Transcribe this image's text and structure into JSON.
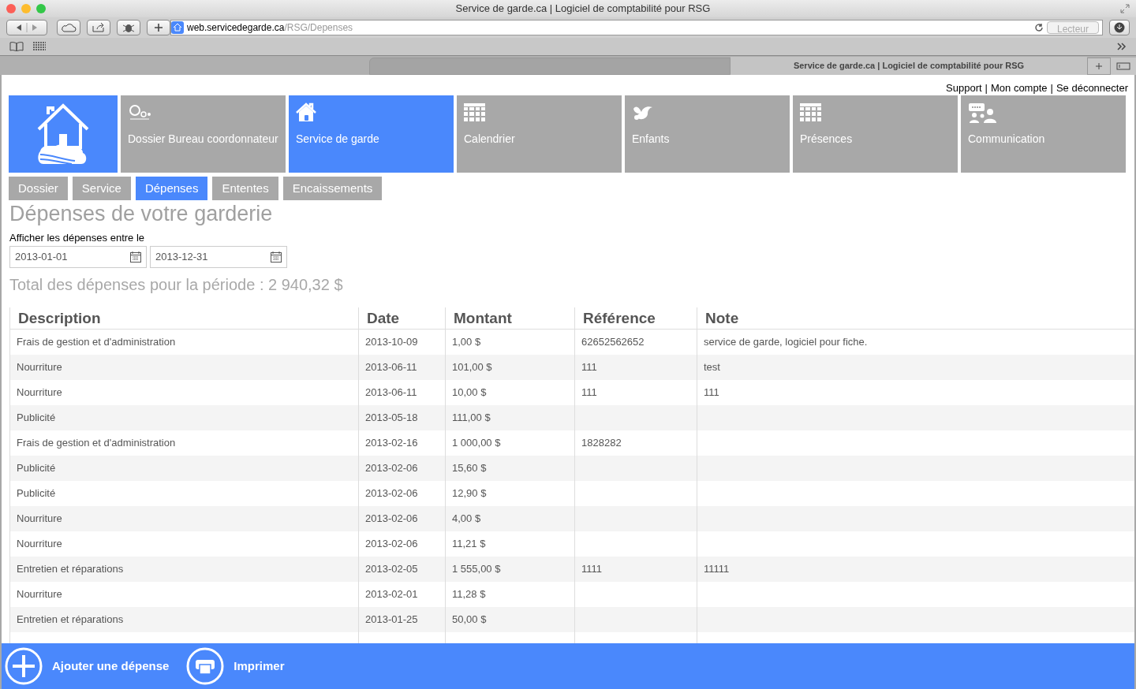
{
  "window": {
    "title": "Service de garde.ca | Logiciel de comptabilité pour RSG"
  },
  "address_bar": {
    "host": "web.servicedegarde.ca",
    "path": "/RSG/Depenses",
    "reader_button": "Lecteur"
  },
  "tab": {
    "title": "Service de garde.ca | Logiciel de comptabilité pour RSG"
  },
  "top_links": [
    {
      "kind": "link",
      "text": "Support"
    },
    {
      "kind": "separator",
      "text": "|"
    },
    {
      "kind": "link",
      "text": "Mon compte"
    },
    {
      "kind": "separator",
      "text": "|"
    },
    {
      "kind": "link",
      "text": "Se déconnecter"
    }
  ],
  "nav_tiles": [
    {
      "kind": "logo",
      "selected": true
    },
    {
      "kind": "balloon",
      "label": "Dossier Bureau coordonnateur",
      "selected": false
    },
    {
      "kind": "house",
      "label": "Service de garde",
      "selected": true
    },
    {
      "kind": "grid",
      "label": "Calendrier",
      "selected": false
    },
    {
      "kind": "bird",
      "label": "Enfants",
      "selected": false
    },
    {
      "kind": "grid",
      "label": "Présences",
      "selected": false
    },
    {
      "kind": "people",
      "label": "Communication",
      "selected": false
    }
  ],
  "sub_tabs": [
    {
      "label": "Dossier",
      "selected": false
    },
    {
      "label": "Service",
      "selected": false
    },
    {
      "label": "Dépenses",
      "selected": true
    },
    {
      "label": "Ententes",
      "selected": false
    },
    {
      "label": "Encaissements",
      "selected": false
    }
  ],
  "heading": "Dépenses de votre garderie",
  "filter": {
    "label": "Afficher les dépenses entre le",
    "start": "2013-01-01",
    "end": "2013-12-31"
  },
  "total": "Total des dépenses pour la période : 2 940,32 $",
  "table": {
    "columns": [
      "Description",
      "Date",
      "Montant",
      "Référence",
      "Note"
    ],
    "rows": [
      [
        "Frais de gestion et d'administration",
        "2013-10-09",
        "1,00 $",
        "62652562652",
        "service de garde, logiciel pour fiche."
      ],
      [
        "Nourriture",
        "2013-06-11",
        "101,00 $",
        "111",
        "test"
      ],
      [
        "Nourriture",
        "2013-06-11",
        "10,00 $",
        "111",
        "111"
      ],
      [
        "Publicité",
        "2013-05-18",
        "111,00 $",
        "",
        ""
      ],
      [
        "Frais de gestion et d'administration",
        "2013-02-16",
        "1 000,00 $",
        "1828282",
        ""
      ],
      [
        "Publicité",
        "2013-02-06",
        "15,60 $",
        "",
        ""
      ],
      [
        "Publicité",
        "2013-02-06",
        "12,90 $",
        "",
        ""
      ],
      [
        "Nourriture",
        "2013-02-06",
        "4,00 $",
        "",
        ""
      ],
      [
        "Nourriture",
        "2013-02-06",
        "11,21 $",
        "",
        ""
      ],
      [
        "Entretien et réparations",
        "2013-02-05",
        "1 555,00 $",
        "1111",
        "11111"
      ],
      [
        "Nourriture",
        "2013-02-01",
        "11,28 $",
        "",
        ""
      ],
      [
        "Entretien et réparations",
        "2013-01-25",
        "50,00 $",
        "",
        ""
      ]
    ]
  },
  "actions": [
    {
      "kind": "add",
      "label": "Ajouter une dépense"
    },
    {
      "kind": "print",
      "label": "Imprimer"
    }
  ]
}
